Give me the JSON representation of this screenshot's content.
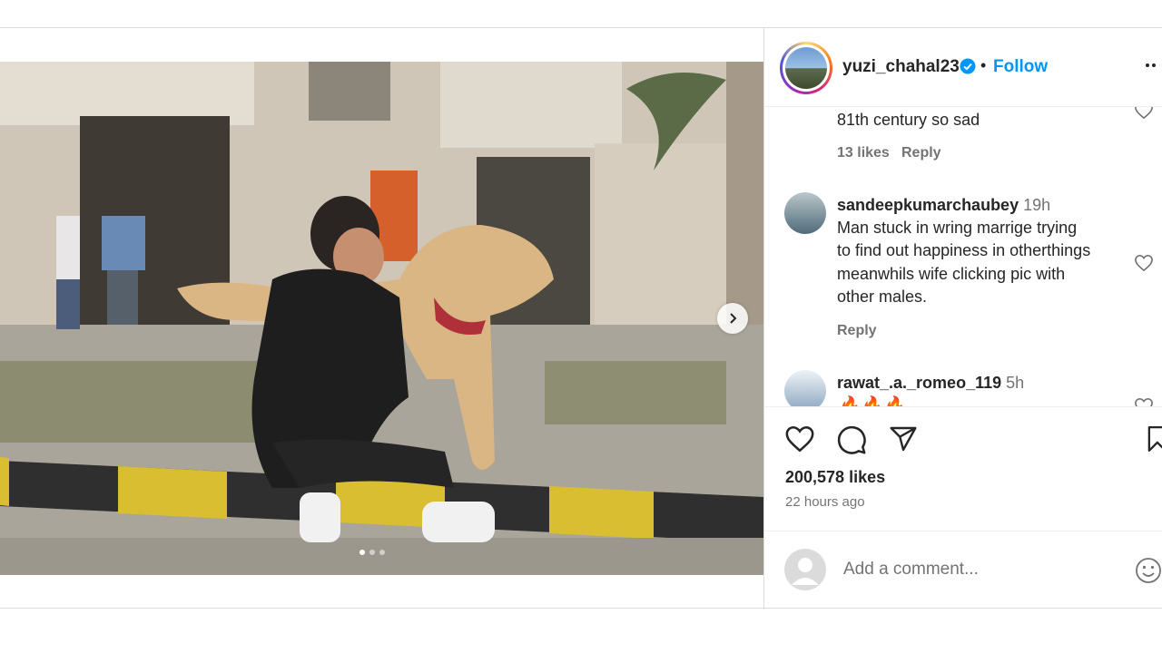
{
  "post": {
    "username": "yuzi_chahal23",
    "follow_label": "Follow",
    "likes": "200,578 likes",
    "time_ago": "22 hours ago",
    "comment_placeholder": "Add a comment...",
    "carousel": {
      "current": 1,
      "total": 3
    }
  },
  "comments": [
    {
      "username": "",
      "time": "",
      "text": "81th century so sad",
      "likes": "13 likes",
      "reply": "Reply"
    },
    {
      "username": "sandeepkumarchaubey",
      "time": "19h",
      "text_lines": [
        "Man stuck in wring marrige trying",
        "to find out happiness in otherthings",
        "meanwhils wife clicking pic with",
        "other males."
      ],
      "reply": "Reply"
    },
    {
      "username": "rawat_.a._romeo_119",
      "time": "5h",
      "text": "🔥🔥🔥"
    }
  ],
  "colors": {
    "follow": "#0095f6",
    "text": "#262626",
    "secondary": "#737373",
    "border": "#dbdbdb"
  },
  "icons": [
    "verified-icon",
    "more-icon",
    "heart-icon",
    "comment-icon",
    "share-icon",
    "save-icon",
    "emoji-icon",
    "chevron-right-icon"
  ]
}
